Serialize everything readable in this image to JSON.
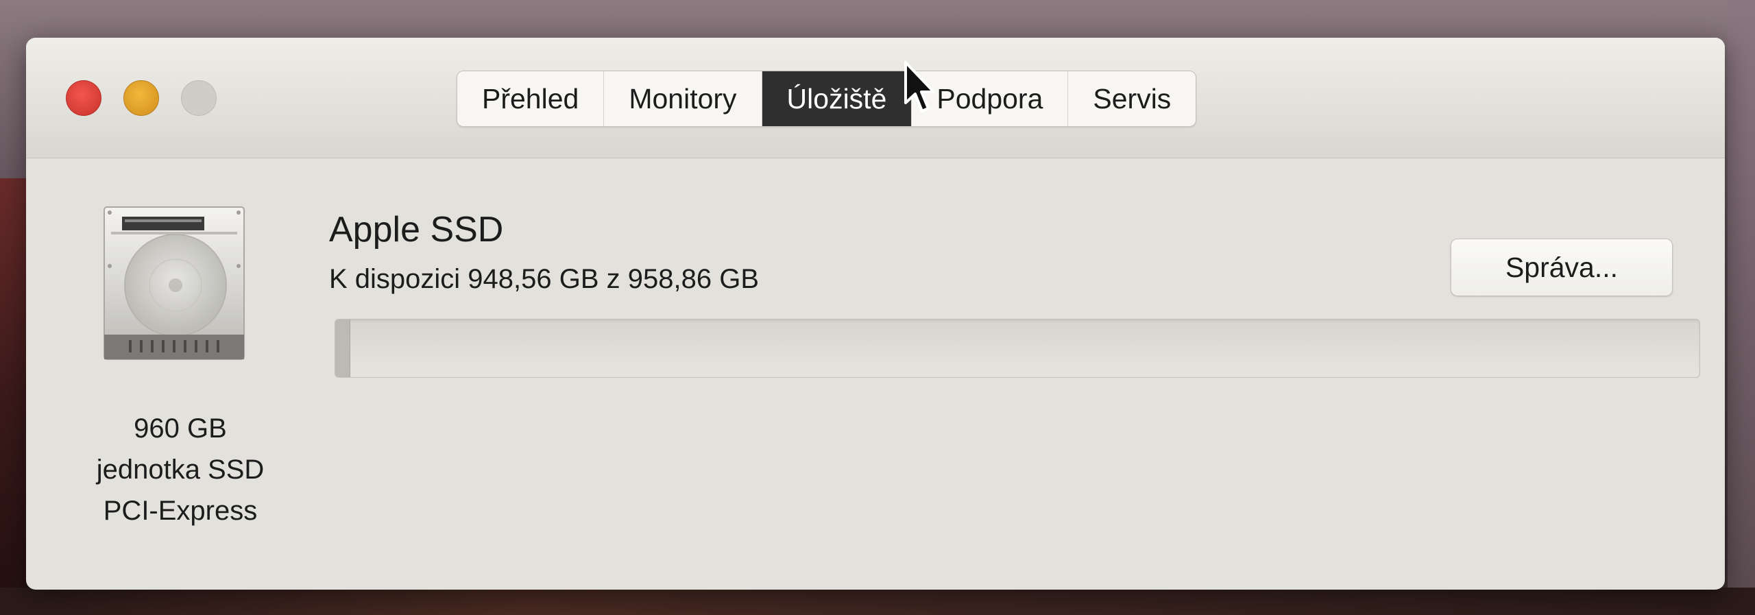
{
  "window": {
    "controls": {
      "close_color": "#e8473f",
      "minimize_color": "#e9a22b",
      "zoom_color": "#cfcdc8"
    }
  },
  "tabs": [
    {
      "label": "Přehled",
      "selected": false
    },
    {
      "label": "Monitory",
      "selected": false
    },
    {
      "label": "Úložiště",
      "selected": true
    },
    {
      "label": "Podpora",
      "selected": false
    },
    {
      "label": "Servis",
      "selected": false
    }
  ],
  "drive": {
    "icon": "hard-drive-icon",
    "caption": [
      "960 GB",
      "jednotka SSD",
      "PCI-Express"
    ],
    "name": "Apple SSD",
    "available_text": "K dispozici 948,56 GB z 958,86 GB",
    "used_fraction": 0.0107,
    "manage_label": "Správa..."
  },
  "colors": {
    "selected_tab": "#2f2f2f",
    "window_bg": "#e3e1dc"
  }
}
